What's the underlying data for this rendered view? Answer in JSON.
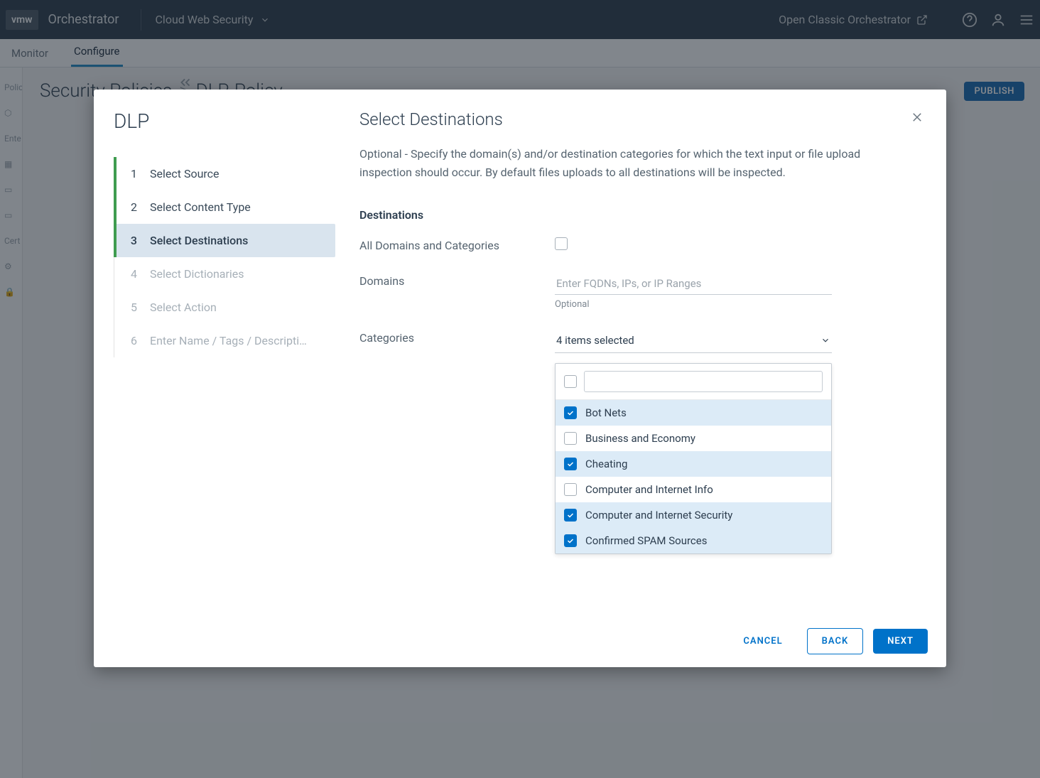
{
  "topbar": {
    "logo": "vmw",
    "brand": "Orchestrator",
    "product": "Cloud Web Security",
    "classic_link": "Open Classic Orchestrator"
  },
  "tabs": {
    "monitor": "Monitor",
    "configure": "Configure"
  },
  "background": {
    "breadcrumb_root": "Security Policies",
    "breadcrumb_sep": ">",
    "breadcrumb_leaf": "DLP-Policy",
    "publish": "PUBLISH",
    "sidebar": {
      "polic": "Polic",
      "ente": "Ente",
      "cert": "Cert"
    }
  },
  "wizard": {
    "title": "DLP",
    "steps": [
      {
        "num": "1",
        "label": "Select Source",
        "state": "done"
      },
      {
        "num": "2",
        "label": "Select Content Type",
        "state": "done"
      },
      {
        "num": "3",
        "label": "Select Destinations",
        "state": "current"
      },
      {
        "num": "4",
        "label": "Select Dictionaries",
        "state": "future"
      },
      {
        "num": "5",
        "label": "Select Action",
        "state": "future"
      },
      {
        "num": "6",
        "label": "Enter Name / Tags / Descripti…",
        "state": "future"
      }
    ]
  },
  "panel": {
    "title": "Select Destinations",
    "description": "Optional - Specify the domain(s) and/or destination categories for which the text input or file upload inspection should occur. By default files uploads to all destinations will be inspected.",
    "section": "Destinations",
    "all_label": "All Domains and Categories",
    "all_checked": false,
    "domains_label": "Domains",
    "domains_placeholder": "Enter FQDNs, IPs, or IP Ranges",
    "domains_hint": "Optional",
    "categories_label": "Categories",
    "categories_summary": "4 items selected",
    "category_items": [
      {
        "label": "Bot Nets",
        "checked": true
      },
      {
        "label": "Business and Economy",
        "checked": false
      },
      {
        "label": "Cheating",
        "checked": true
      },
      {
        "label": "Computer and Internet Info",
        "checked": false
      },
      {
        "label": "Computer and Internet Security",
        "checked": true
      },
      {
        "label": "Confirmed SPAM Sources",
        "checked": true
      }
    ]
  },
  "footer": {
    "cancel": "CANCEL",
    "back": "BACK",
    "next": "NEXT"
  }
}
